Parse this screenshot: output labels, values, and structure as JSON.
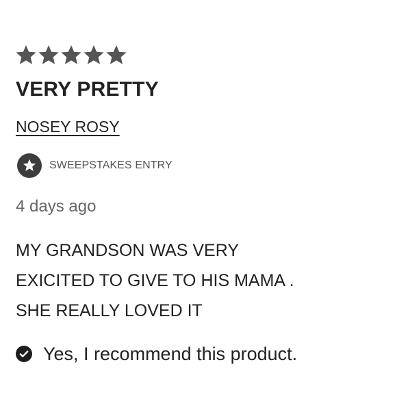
{
  "review": {
    "rating": 5,
    "rating_max": 5,
    "star_color": "#555555",
    "title": "VERY PRETTY",
    "author": "NOSEY ROSY",
    "badge": {
      "icon": "star-badge-icon",
      "label": "SWEEPSTAKES ENTRY"
    },
    "date": "4 days ago",
    "body_lines": [
      "MY GRANDSON WAS VERY",
      "EXICITED TO GIVE TO HIS MAMA .",
      "SHE REALLY LOVED IT"
    ],
    "recommend": {
      "icon": "check-circle-icon",
      "text": "Yes, I recommend this product."
    }
  }
}
